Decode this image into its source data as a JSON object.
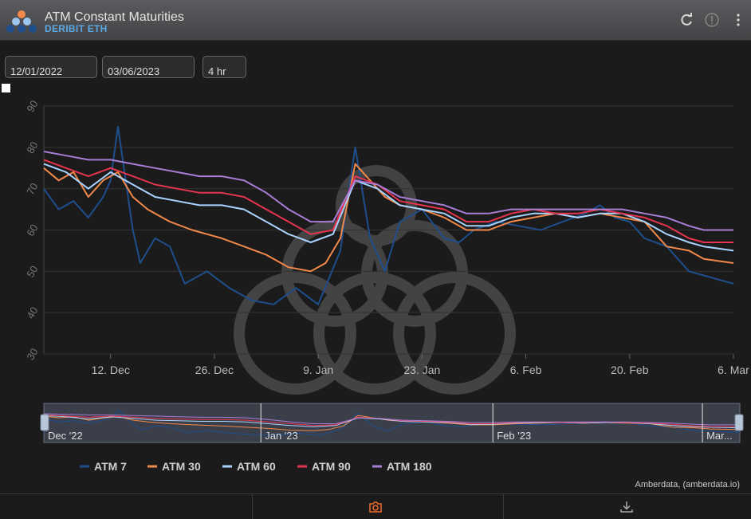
{
  "header": {
    "title": "ATM Constant Maturities",
    "subtitle": "DERIBIT ETH"
  },
  "controls": {
    "start_date": "12/01/2022",
    "end_date": "03/06/2023",
    "interval": "4 hr"
  },
  "credit": "Amberdata, (amberdata.io)",
  "colors": {
    "ATM 7": "#1f4e8c",
    "ATM 30": "#f2894a",
    "ATM 60": "#a9d4ff",
    "ATM 90": "#e6344e",
    "ATM 180": "#a87dd6",
    "accent": "#f26b2a"
  },
  "chart_data": {
    "type": "line",
    "title": "",
    "xlabel": "",
    "ylabel": "",
    "x_range": [
      "2022-12-03",
      "2023-03-06"
    ],
    "ylim": [
      30,
      90
    ],
    "yticks": [
      30,
      40,
      50,
      60,
      70,
      80,
      90
    ],
    "xticks": [
      {
        "date": "2022-12-12",
        "label": "12. Dec"
      },
      {
        "date": "2022-12-26",
        "label": "26. Dec"
      },
      {
        "date": "2023-01-09",
        "label": "9. Jan"
      },
      {
        "date": "2023-01-23",
        "label": "23. Jan"
      },
      {
        "date": "2023-02-06",
        "label": "6. Feb"
      },
      {
        "date": "2023-02-20",
        "label": "20. Feb"
      },
      {
        "date": "2023-03-06",
        "label": "6. Mar"
      }
    ],
    "navigator_labels": [
      {
        "date": "2022-12-03",
        "label": "Dec '22"
      },
      {
        "date": "2023-01-01",
        "label": "Jan '23"
      },
      {
        "date": "2023-02-01",
        "label": "Feb '23"
      },
      {
        "date": "2023-03-01",
        "label": "Mar..."
      }
    ],
    "grid": true,
    "legend_position": "bottom",
    "series": [
      {
        "name": "ATM 7",
        "x": [
          "2022-12-03",
          "2022-12-05",
          "2022-12-07",
          "2022-12-09",
          "2022-12-11",
          "2022-12-12",
          "2022-12-13",
          "2022-12-15",
          "2022-12-16",
          "2022-12-18",
          "2022-12-20",
          "2022-12-22",
          "2022-12-25",
          "2022-12-28",
          "2022-12-31",
          "2023-01-03",
          "2023-01-06",
          "2023-01-09",
          "2023-01-12",
          "2023-01-13",
          "2023-01-14",
          "2023-01-16",
          "2023-01-18",
          "2023-01-20",
          "2023-01-23",
          "2023-01-26",
          "2023-01-28",
          "2023-01-30",
          "2023-02-02",
          "2023-02-05",
          "2023-02-08",
          "2023-02-11",
          "2023-02-14",
          "2023-02-16",
          "2023-02-18",
          "2023-02-20",
          "2023-02-22",
          "2023-02-25",
          "2023-02-28",
          "2023-03-02",
          "2023-03-06"
        ],
        "y": [
          70,
          65,
          67,
          63,
          68,
          72,
          85,
          60,
          52,
          58,
          56,
          47,
          50,
          46,
          43,
          42,
          46,
          42,
          55,
          68,
          80,
          58,
          50,
          62,
          65,
          58,
          57,
          60,
          62,
          61,
          60,
          62,
          64,
          66,
          63,
          62,
          58,
          56,
          50,
          49,
          47
        ]
      },
      {
        "name": "ATM 30",
        "x": [
          "2022-12-03",
          "2022-12-05",
          "2022-12-07",
          "2022-12-09",
          "2022-12-11",
          "2022-12-13",
          "2022-12-15",
          "2022-12-17",
          "2022-12-20",
          "2022-12-23",
          "2022-12-27",
          "2022-12-30",
          "2023-01-02",
          "2023-01-05",
          "2023-01-08",
          "2023-01-10",
          "2023-01-12",
          "2023-01-14",
          "2023-01-16",
          "2023-01-18",
          "2023-01-20",
          "2023-01-23",
          "2023-01-26",
          "2023-01-29",
          "2023-02-01",
          "2023-02-04",
          "2023-02-07",
          "2023-02-10",
          "2023-02-13",
          "2023-02-16",
          "2023-02-19",
          "2023-02-22",
          "2023-02-25",
          "2023-02-28",
          "2023-03-02",
          "2023-03-06"
        ],
        "y": [
          75,
          72,
          74,
          68,
          72,
          74,
          68,
          65,
          62,
          60,
          58,
          56,
          54,
          51,
          50,
          52,
          58,
          76,
          72,
          68,
          66,
          65,
          63,
          60,
          60,
          62,
          63,
          64,
          63,
          64,
          63,
          62,
          56,
          55,
          53,
          52
        ]
      },
      {
        "name": "ATM 60",
        "x": [
          "2022-12-03",
          "2022-12-06",
          "2022-12-09",
          "2022-12-12",
          "2022-12-15",
          "2022-12-18",
          "2022-12-21",
          "2022-12-24",
          "2022-12-27",
          "2022-12-30",
          "2023-01-02",
          "2023-01-05",
          "2023-01-08",
          "2023-01-11",
          "2023-01-14",
          "2023-01-17",
          "2023-01-20",
          "2023-01-23",
          "2023-01-26",
          "2023-01-29",
          "2023-02-01",
          "2023-02-04",
          "2023-02-07",
          "2023-02-10",
          "2023-02-13",
          "2023-02-16",
          "2023-02-19",
          "2023-02-22",
          "2023-02-25",
          "2023-02-28",
          "2023-03-02",
          "2023-03-06"
        ],
        "y": [
          76,
          74,
          70,
          74,
          71,
          68,
          67,
          66,
          66,
          65,
          62,
          59,
          57,
          59,
          72,
          70,
          66,
          65,
          64,
          61,
          61,
          63,
          64,
          64,
          63,
          64,
          64,
          62,
          59,
          57,
          56,
          55
        ]
      },
      {
        "name": "ATM 90",
        "x": [
          "2022-12-03",
          "2022-12-06",
          "2022-12-09",
          "2022-12-12",
          "2022-12-15",
          "2022-12-18",
          "2022-12-21",
          "2022-12-24",
          "2022-12-27",
          "2022-12-30",
          "2023-01-02",
          "2023-01-05",
          "2023-01-08",
          "2023-01-11",
          "2023-01-14",
          "2023-01-17",
          "2023-01-20",
          "2023-01-23",
          "2023-01-26",
          "2023-01-29",
          "2023-02-01",
          "2023-02-04",
          "2023-02-07",
          "2023-02-10",
          "2023-02-13",
          "2023-02-16",
          "2023-02-19",
          "2023-02-22",
          "2023-02-25",
          "2023-02-28",
          "2023-03-02",
          "2023-03-06"
        ],
        "y": [
          77,
          75,
          73,
          75,
          73,
          71,
          70,
          69,
          69,
          68,
          65,
          62,
          59,
          60,
          73,
          71,
          67,
          66,
          65,
          62,
          62,
          64,
          65,
          64,
          64,
          65,
          64,
          63,
          61,
          58,
          57,
          57
        ]
      },
      {
        "name": "ATM 180",
        "x": [
          "2022-12-03",
          "2022-12-06",
          "2022-12-09",
          "2022-12-12",
          "2022-12-15",
          "2022-12-18",
          "2022-12-21",
          "2022-12-24",
          "2022-12-27",
          "2022-12-30",
          "2023-01-02",
          "2023-01-05",
          "2023-01-08",
          "2023-01-11",
          "2023-01-14",
          "2023-01-17",
          "2023-01-20",
          "2023-01-23",
          "2023-01-26",
          "2023-01-29",
          "2023-02-01",
          "2023-02-04",
          "2023-02-07",
          "2023-02-10",
          "2023-02-13",
          "2023-02-16",
          "2023-02-19",
          "2023-02-22",
          "2023-02-25",
          "2023-02-28",
          "2023-03-02",
          "2023-03-06"
        ],
        "y": [
          79,
          78,
          77,
          77,
          76,
          75,
          74,
          73,
          73,
          72,
          69,
          65,
          62,
          62,
          72,
          71,
          68,
          67,
          66,
          64,
          64,
          65,
          65,
          65,
          65,
          65,
          65,
          64,
          63,
          61,
          60,
          60
        ]
      }
    ]
  },
  "footer": {
    "camera_icon": "camera-icon",
    "download_icon": "download-icon"
  }
}
